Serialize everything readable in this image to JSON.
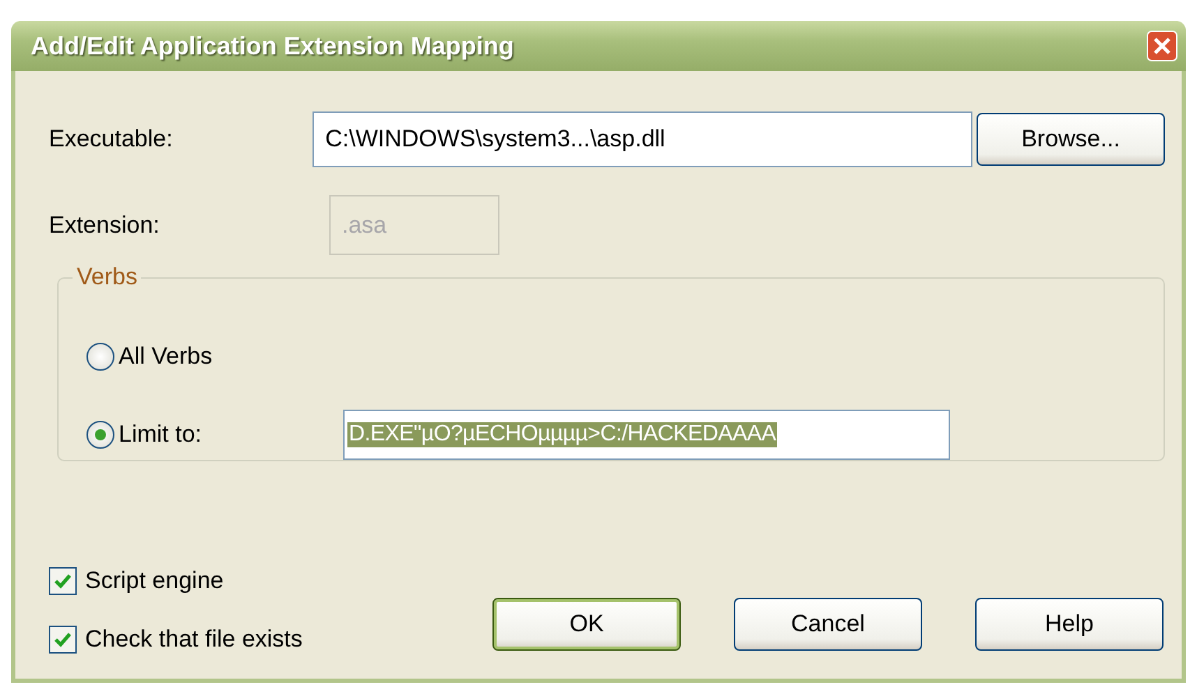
{
  "window": {
    "title": "Add/Edit Application Extension Mapping"
  },
  "executable": {
    "label": "Executable:",
    "value": "C:\\WINDOWS\\system3...\\asp.dll",
    "browse_button": "Browse..."
  },
  "extension": {
    "label": "Extension:",
    "value": ".asa",
    "disabled": true
  },
  "verbs": {
    "title": "Verbs",
    "options": [
      {
        "label": "All Verbs",
        "selected": false
      },
      {
        "label": "Limit to:",
        "selected": true,
        "value": "D.EXE\"µO?µECHOµµµµ>C:/HACKEDAAAA"
      }
    ]
  },
  "checkboxes": [
    {
      "label": "Script engine",
      "checked": true
    },
    {
      "label": "Check that file exists",
      "checked": true
    }
  ],
  "buttons": [
    {
      "label": "OK",
      "default": true
    },
    {
      "label": "Cancel",
      "default": false
    },
    {
      "label": "Help",
      "default": false
    }
  ]
}
